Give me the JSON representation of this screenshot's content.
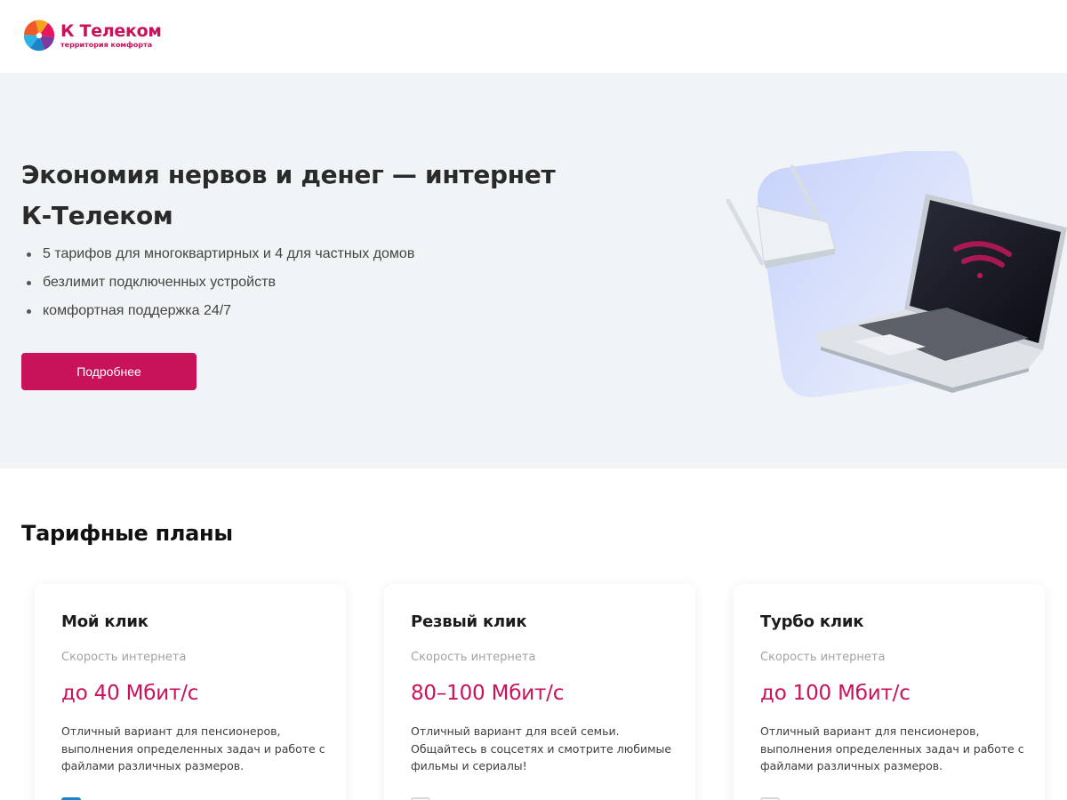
{
  "header": {
    "logo_name": "К Телеком",
    "logo_tagline": "территория комфорта"
  },
  "hero": {
    "title": "Экономия нервов и денег — интернет К-Телеком",
    "bullets": [
      "5 тарифов для многоквартирных и 4 для частных домов",
      "безлимит подключенных устройств",
      "комфортная поддержка 24/7"
    ],
    "cta_label": "Подробнее"
  },
  "tariffs": {
    "title": "Тарифные планы",
    "cards": [
      {
        "name": "Мой клик",
        "speed_label": "Скорость интернета",
        "speed": "до 40 Мбит/с",
        "description": "Отличный вариант для пенсионеров, выполнения определенных задач и работе с файлами различных размеров.",
        "checked": true
      },
      {
        "name": "Резвый клик",
        "speed_label": "Скорость интернета",
        "speed": "80–100 Мбит/с",
        "description": "Отличный вариант для всей семьи. Общайтесь в соцсетях и смотрите любимые фильмы и сериалы!",
        "checked": false
      },
      {
        "name": "Турбо клик",
        "speed_label": "Скорость интернета",
        "speed": "до 100 Мбит/с",
        "description": "Отличный вариант для пенсионеров, выполнения определенных задач и работе с файлами различных размеров.",
        "checked": false
      }
    ]
  },
  "colors": {
    "brand": "#c8125a",
    "hero_bg": "#f1f4f7",
    "checkbox_active": "#1b84c6"
  },
  "icons": [
    "k-telecom-logo-icon",
    "router-icon",
    "laptop-icon",
    "wifi-icon"
  ]
}
